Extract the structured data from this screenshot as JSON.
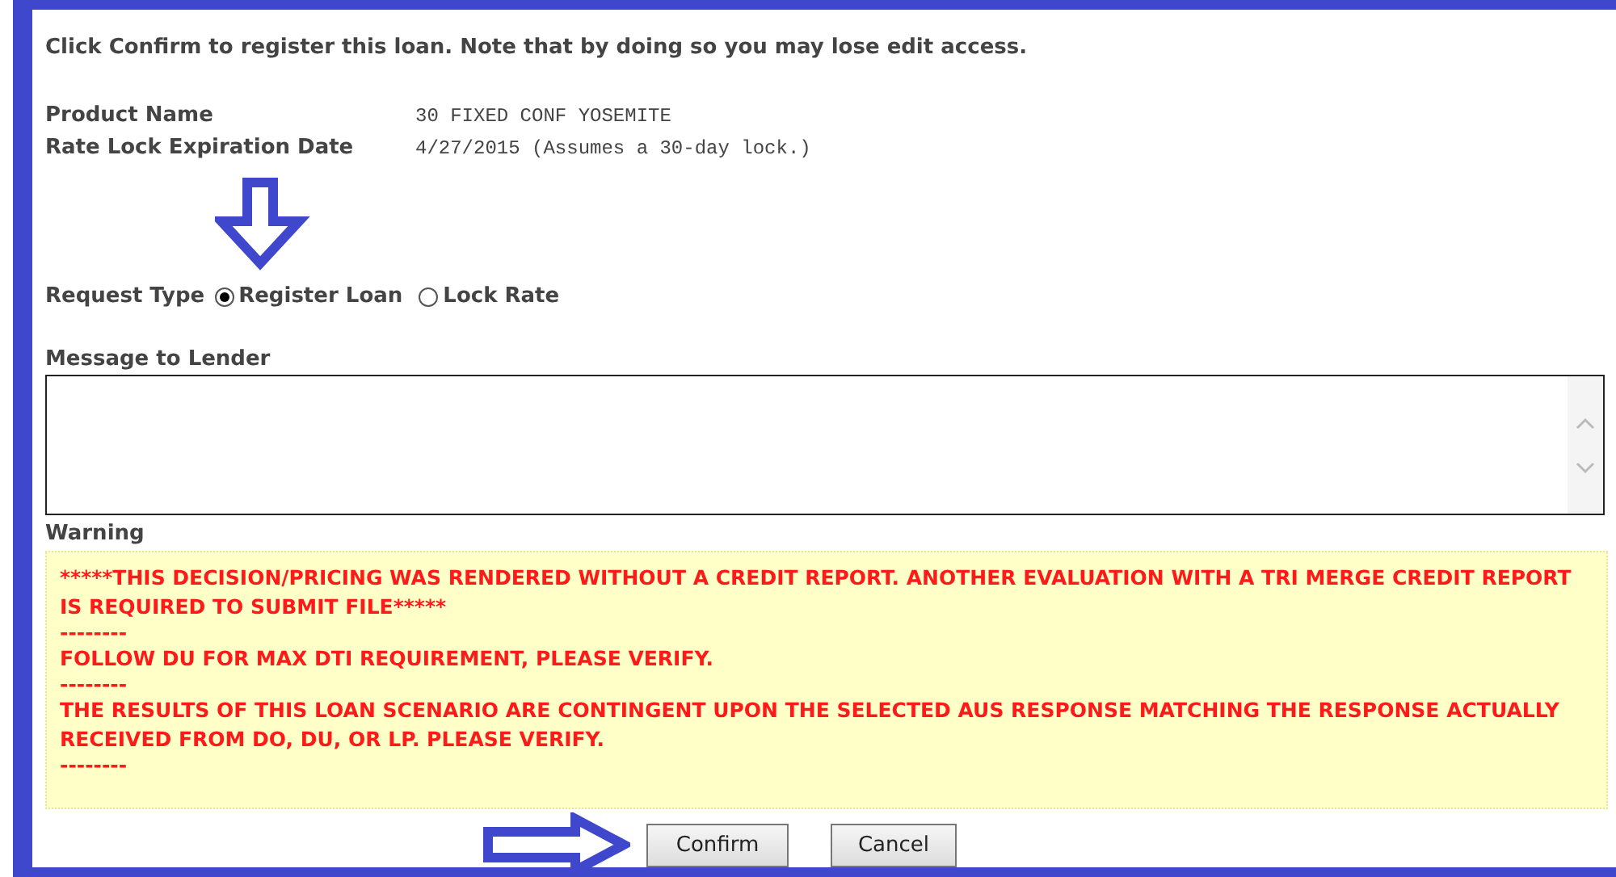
{
  "intro": "Click Confirm to register this loan. Note that by doing so you may lose edit access.",
  "details": [
    {
      "label": "Product Name",
      "value": "30 FIXED CONF YOSEMITE"
    },
    {
      "label": "Rate Lock Expiration Date",
      "value": "4/27/2015 (Assumes a 30-day lock.)"
    }
  ],
  "request_type": {
    "label": "Request Type",
    "options": [
      {
        "label": "Register Loan",
        "selected": true
      },
      {
        "label": "Lock Rate",
        "selected": false
      }
    ]
  },
  "message": {
    "label": "Message to Lender"
  },
  "warning": {
    "label": "Warning",
    "lines": [
      {
        "kind": "message",
        "text": "*****THIS DECISION/PRICING WAS RENDERED WITHOUT A CREDIT REPORT. ANOTHER EVALUATION WITH A TRI MERGE CREDIT REPORT IS REQUIRED TO SUBMIT FILE*****"
      },
      {
        "kind": "separator",
        "text": "--------"
      },
      {
        "kind": "message",
        "text": "FOLLOW DU FOR MAX DTI REQUIREMENT, PLEASE VERIFY."
      },
      {
        "kind": "separator",
        "text": "--------"
      },
      {
        "kind": "message",
        "text": "THE RESULTS OF THIS LOAN SCENARIO ARE CONTINGENT UPON THE SELECTED AUS RESPONSE MATCHING THE RESPONSE ACTUALLY RECEIVED FROM DO, DU, OR LP. PLEASE VERIFY."
      },
      {
        "kind": "separator",
        "text": "--------"
      }
    ]
  },
  "buttons": [
    "Confirm",
    "Cancel"
  ]
}
